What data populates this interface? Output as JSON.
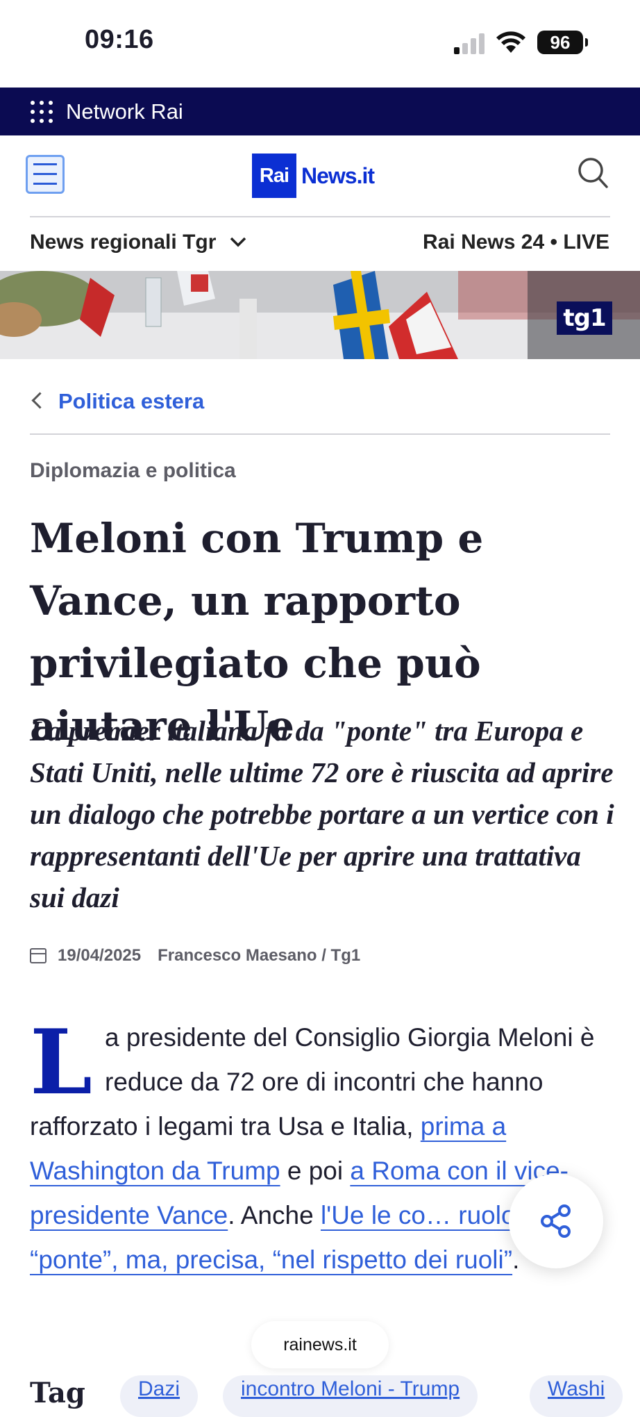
{
  "status": {
    "time": "09:16",
    "battery": "96"
  },
  "network_bar": {
    "label": "Network Rai"
  },
  "header": {
    "logo_rai": "Rai",
    "logo_news": "News.it"
  },
  "nav": {
    "regional": "News regionali Tgr",
    "live": "Rai News 24 • LIVE"
  },
  "hero": {
    "badge": "tg1"
  },
  "breadcrumb": {
    "label": "Politica estera"
  },
  "article": {
    "kicker": "Diplomazia e politica",
    "title": "Meloni con Trump e Vance, un rapporto privilegiato che può aiutare l'Ue",
    "subtitle": "La premier italiana fa da \"ponte\" tra Europa e Stati Uniti, nelle ultime 72 ore è riuscita ad aprire un dialogo che potrebbe portare a un vertice con i rappresentanti dell'Ue per aprire una trattativa sui dazi",
    "date": "19/04/2025",
    "author": "Francesco Maesano / Tg1",
    "dropcap": "L",
    "body_1": "a presidente del Consiglio Giorgia Meloni è reduce da 72 ore di incontri che hanno rafforzato i legami tra Usa e Italia, ",
    "link_1": "prima a Washington da Trump",
    "body_2": " e poi ",
    "link_2": "a Roma con il vice-presidente Vance",
    "body_3": ". Anche ",
    "link_3": "l'Ue le co… ruolo di “ponte”, ma, precisa, “nel rispetto dei ruoli”",
    "body_4": "."
  },
  "tags": {
    "label": "Tag",
    "items": [
      "Dazi",
      "incontro Meloni - Trump",
      "Washi"
    ]
  },
  "browser": {
    "url": "rainews.it"
  },
  "colors": {
    "brand_blue": "#0b2fd3",
    "network_bar": "#0b0b52",
    "link": "#2f5fd9",
    "dropcap": "#0b1fa8"
  }
}
